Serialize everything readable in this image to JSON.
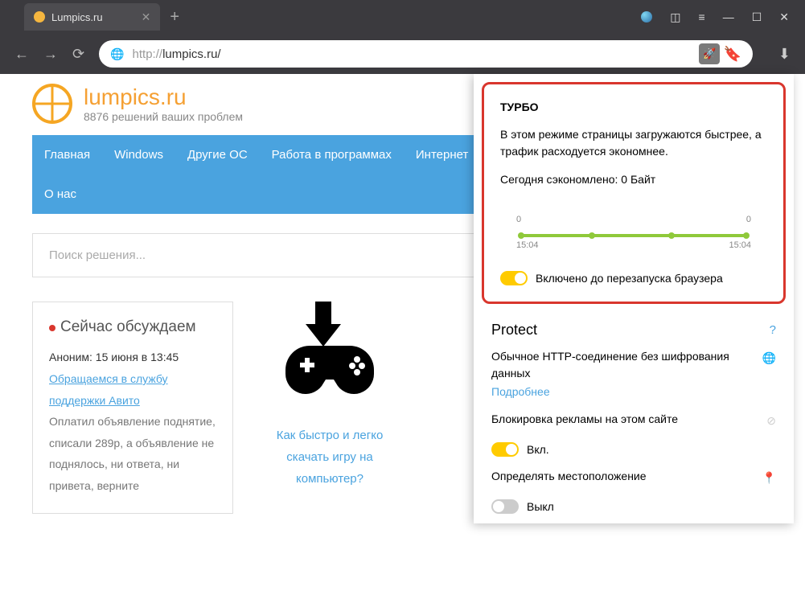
{
  "tab": {
    "title": "Lumpics.ru"
  },
  "url": {
    "prefix": "http://",
    "host": "lumpics.ru/"
  },
  "site": {
    "title": "lumpics.ru",
    "subtitle": "8876 решений ваших проблем"
  },
  "nav": [
    "Главная",
    "Windows",
    "Другие ОС",
    "Работа в программах",
    "Интернет",
    "О нас"
  ],
  "search": {
    "placeholder": "Поиск решения..."
  },
  "sidebar": {
    "title": "Сейчас обсуждаем",
    "meta": "Аноним: 15 июня в 13:45",
    "link1": "Обращаемся в службу",
    "link2": "поддержки Авито",
    "body": "Оплатил объявление поднятие, списали 289р, а объявление не поднялось, ни ответа, ни привета, верните"
  },
  "article": {
    "l1": "Как быстро и легко",
    "l2": "скачать игру на",
    "l3": "компьютер?"
  },
  "turbo": {
    "title": "ТУРБО",
    "desc": "В этом режиме страницы загружаются быстрее, а трафик расходуется экономнее.",
    "saved": "Сегодня сэкономлено: 0 Байт",
    "chart": {
      "start_val": "0",
      "end_val": "0",
      "start_time": "15:04",
      "end_time": "15:04"
    },
    "toggle_label": "Включено до перезапуска браузера"
  },
  "protect": {
    "title": "Protect",
    "help": "?",
    "http": "Обычное HTTP-соединение без шифрования данных",
    "more": "Подробнее",
    "ads": "Блокировка рекламы на этом сайте",
    "ads_state": "Вкл.",
    "geo": "Определять местоположение",
    "geo_state": "Выкл"
  }
}
